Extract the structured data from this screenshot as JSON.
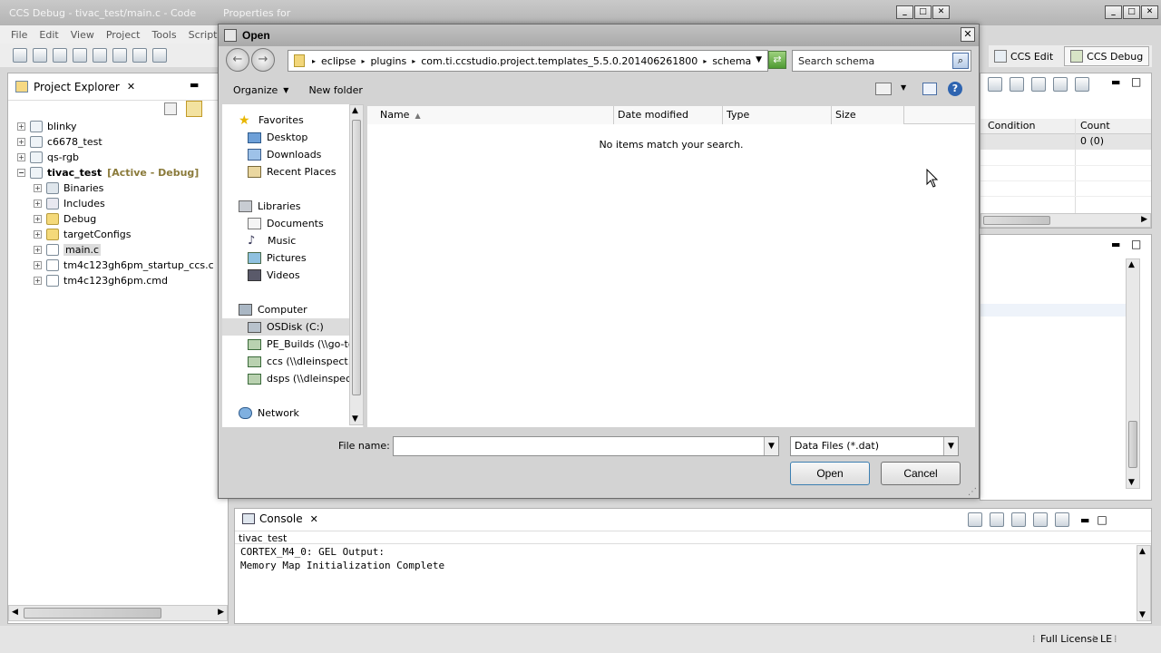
{
  "window": {
    "title": "CCS Debug - tivac_test/main.c - Code",
    "props_title": "Properties for"
  },
  "menu": [
    "File",
    "Edit",
    "View",
    "Project",
    "Tools",
    "Scripts"
  ],
  "project_explorer": {
    "title": "Project Explorer",
    "items": [
      {
        "label": "blinky",
        "level": 0
      },
      {
        "label": "c6678_test",
        "level": 0
      },
      {
        "label": "qs-rgb",
        "level": 0
      },
      {
        "label": "tivac_test",
        "level": 0,
        "active": "[Active - Debug]"
      },
      {
        "label": "Binaries",
        "level": 1
      },
      {
        "label": "Includes",
        "level": 1
      },
      {
        "label": "Debug",
        "level": 1
      },
      {
        "label": "targetConfigs",
        "level": 1
      },
      {
        "label": "main.c",
        "level": 1
      },
      {
        "label": "tm4c123gh6pm_startup_ccs.c",
        "level": 1
      },
      {
        "label": "tm4c123gh6pm.cmd",
        "level": 1
      }
    ]
  },
  "perspectives": {
    "edit": "CCS Edit",
    "debug": "CCS Debug"
  },
  "breakpoints": {
    "headers": [
      "Condition",
      "Count"
    ],
    "row": [
      "",
      "0 (0)"
    ]
  },
  "console": {
    "title": "Console",
    "project": "tivac_test",
    "lines": [
      "CORTEX_M4_0: GEL Output:",
      "Memory Map Initialization Complete"
    ]
  },
  "status": {
    "license": "Full License",
    "endian": "LE"
  },
  "dialog": {
    "title": "Open",
    "breadcrumbs": [
      "eclipse",
      "plugins",
      "com.ti.ccstudio.project.templates_5.5.0.201406261800",
      "schema"
    ],
    "search_placeholder": "Search schema",
    "organize": "Organize",
    "new_folder": "New folder",
    "nav": {
      "favorites": "Favorites",
      "favorites_items": [
        "Desktop",
        "Downloads",
        "Recent Places"
      ],
      "libraries": "Libraries",
      "libraries_items": [
        "Documents",
        "Music",
        "Pictures",
        "Videos"
      ],
      "computer": "Computer",
      "computer_items": [
        "OSDisk (C:)",
        "PE_Builds (\\\\go-tor",
        "ccs (\\\\dleinspect.itg",
        "dsps (\\\\dleinspect.i"
      ],
      "network": "Network"
    },
    "columns": [
      "Name",
      "Date modified",
      "Type",
      "Size"
    ],
    "empty_message": "No items match your search.",
    "filename_label": "File name:",
    "filename_value": "",
    "filetype": "Data Files (*.dat)",
    "open": "Open",
    "cancel": "Cancel"
  }
}
